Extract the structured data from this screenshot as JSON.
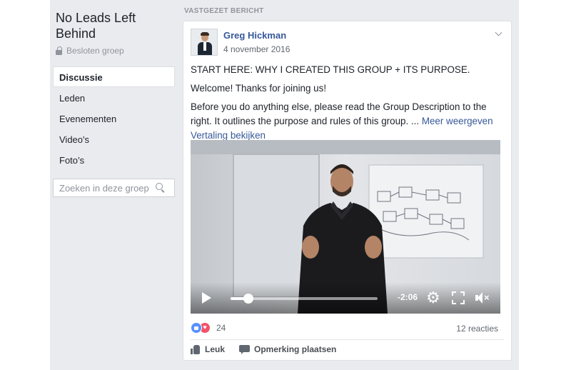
{
  "group": {
    "title": "No Leads Left Behind",
    "privacy": "Besloten groep"
  },
  "nav": {
    "items": [
      {
        "label": "Discussie",
        "active": true
      },
      {
        "label": "Leden",
        "active": false
      },
      {
        "label": "Evenementen",
        "active": false
      },
      {
        "label": "Video's",
        "active": false
      },
      {
        "label": "Foto’s",
        "active": false
      }
    ]
  },
  "search": {
    "placeholder": "Zoeken in deze groep",
    "icon": "search-icon"
  },
  "post": {
    "pinned_label": "VASTGEZET BERICHT",
    "author": "Greg Hickman",
    "date": "4 november 2016",
    "headline": "START HERE: WHY I CREATED THIS GROUP + ITS PURPOSE.",
    "welcome": "Welcome! Thanks for joining us!",
    "body": "Before you do anything else, please read the Group Description to the right. It outlines the purpose and rules of this group. ...",
    "more_link": "Meer weergeven",
    "translate_link": "Vertaling bekijken",
    "video": {
      "time_remaining": "-2:06",
      "progress": 0.12
    },
    "reaction_count": "24",
    "comments_count": "12 reacties",
    "actions": {
      "like": "Leuk",
      "comment": "Opmerking plaatsen"
    }
  },
  "colors": {
    "link": "#365899",
    "page_bg": "#e9ebee",
    "like_blue": "#5890ff",
    "love_red": "#f25268"
  }
}
